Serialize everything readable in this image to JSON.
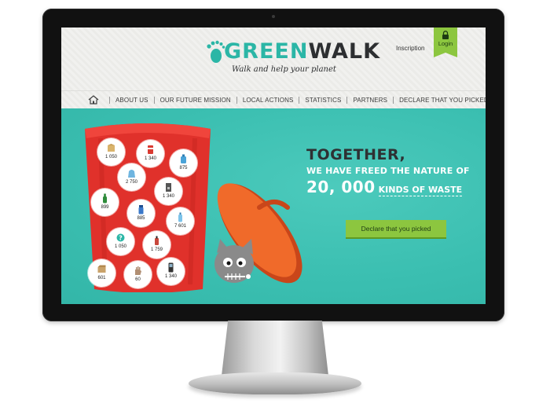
{
  "header": {
    "logo_green": "GREEN",
    "logo_walk": "WALK",
    "tagline": "Walk and help your planet",
    "inscription_label": "Inscription",
    "login_label": "Login"
  },
  "nav": {
    "items": [
      {
        "label": "ABOUT US"
      },
      {
        "label": "OUR FUTURE MISSION"
      },
      {
        "label": "LOCAL ACTIONS"
      },
      {
        "label": "STATISTICS"
      },
      {
        "label": "PARTNERS"
      },
      {
        "label": "DECLARE THAT YOU PICKED"
      }
    ]
  },
  "hero": {
    "line1": "TOGETHER,",
    "line2": "WE HAVE FREED THE NATURE OF",
    "count": "20, 000",
    "line3_suffix": "KINDS OF WASTE",
    "cta_label": "Declare that you picked"
  },
  "counters": [
    {
      "value": "1 050",
      "icon": "cardboard-box-icon",
      "color": "#d9b36c"
    },
    {
      "value": "1 340",
      "icon": "can-icon",
      "color": "#d93a32"
    },
    {
      "value": "875",
      "icon": "water-jug-icon",
      "color": "#4aa3d8"
    },
    {
      "value": "2 750",
      "icon": "plastic-bag-icon",
      "color": "#6fb5e0"
    },
    {
      "value": "1 340",
      "icon": "coffee-machine-icon",
      "color": "#555555"
    },
    {
      "value": "899",
      "icon": "green-bottle-icon",
      "color": "#2e8b3a"
    },
    {
      "value": "885",
      "icon": "spray-bottle-icon",
      "color": "#3a78c9"
    },
    {
      "value": "7 601",
      "icon": "plastic-bottle-icon",
      "color": "#7cc3ea"
    },
    {
      "value": "1 050",
      "icon": "question-icon",
      "color": "#2bb6a6"
    },
    {
      "value": "1 759",
      "icon": "tube-icon",
      "color": "#c8473c"
    },
    {
      "value": "601",
      "icon": "cardboard-icon",
      "color": "#c9a26a"
    },
    {
      "value": "60",
      "icon": "glove-icon",
      "color": "#b08e73"
    },
    {
      "value": "1 340",
      "icon": "phone-icon",
      "color": "#333333"
    }
  ],
  "colors": {
    "teal": "#3cc1b3",
    "brand_green": "#8cc63f",
    "bin_red": "#e0312b",
    "lid_orange": "#f06a2a"
  }
}
